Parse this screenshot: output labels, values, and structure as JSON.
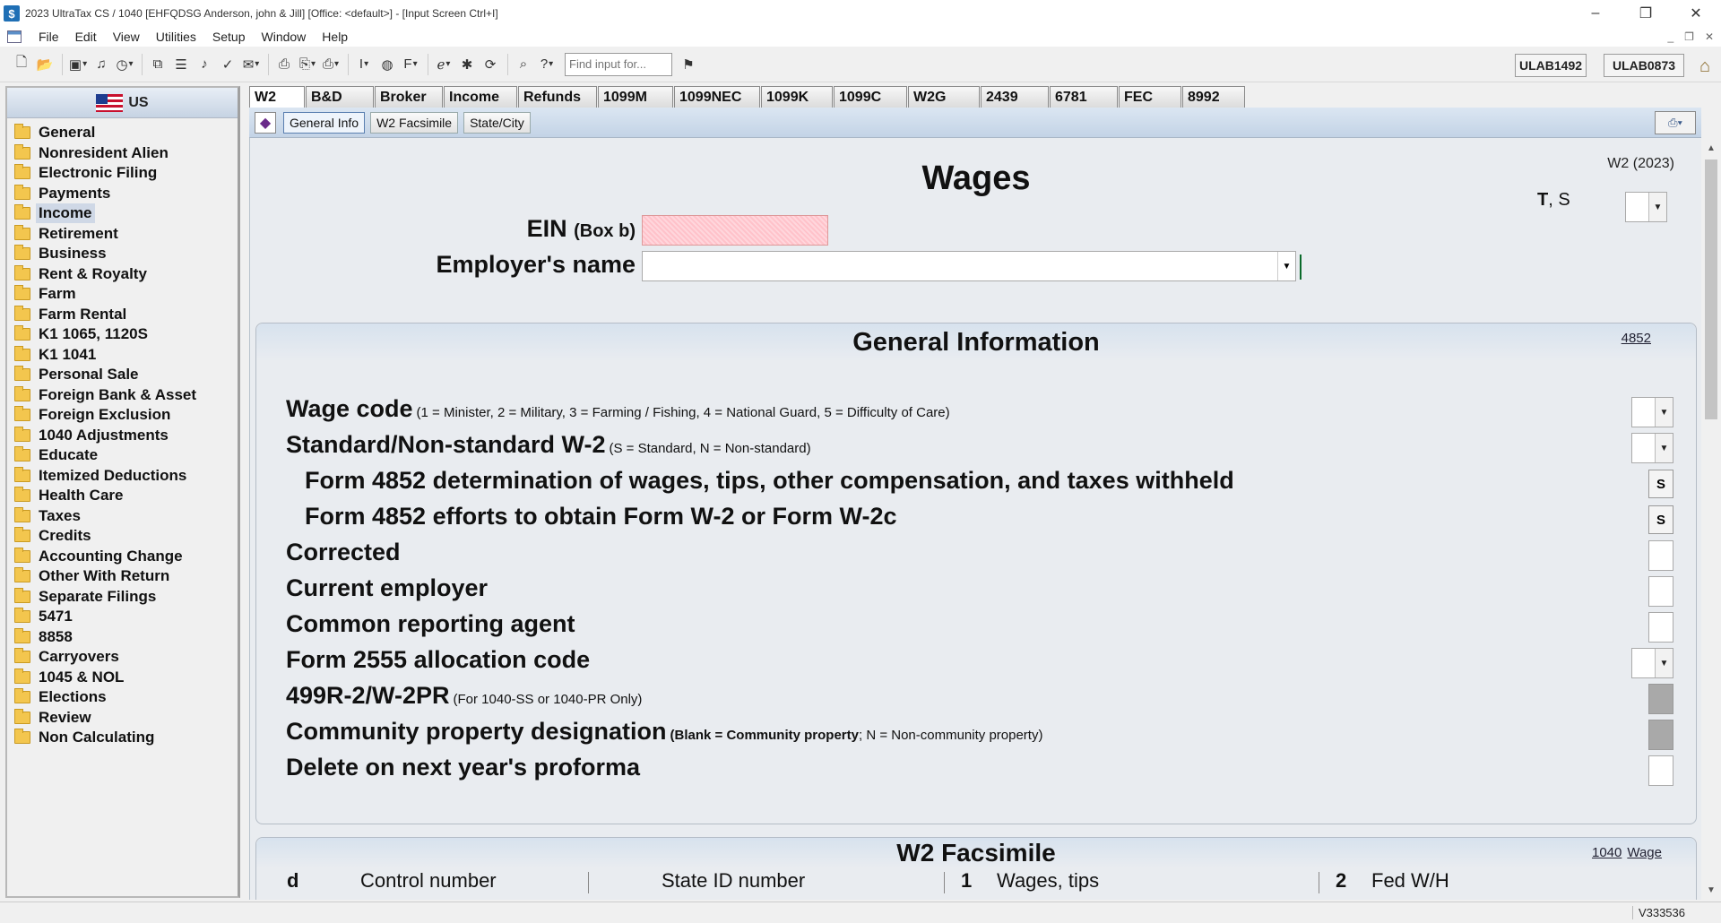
{
  "window": {
    "title": "2023 UltraTax CS  / 1040 [EHFQDSG Anderson, john & Jill] [Office: <default>] - [Input Screen     Ctrl+I]",
    "app_icon": "$"
  },
  "menu": [
    "File",
    "Edit",
    "View",
    "Utilities",
    "Setup",
    "Window",
    "Help"
  ],
  "toolbar": {
    "find_placeholder": "Find input for...",
    "user1": "ULAB1492",
    "user2": "ULAB0873"
  },
  "sidebar": {
    "header": "US",
    "selected": "Income",
    "items": [
      "General",
      "Nonresident Alien",
      "Electronic Filing",
      "Payments",
      "Income",
      "Retirement",
      "Business",
      "Rent & Royalty",
      "Farm",
      "Farm Rental",
      "K1 1065, 1120S",
      "K1 1041",
      "Personal Sale",
      "Foreign Bank & Asset",
      "Foreign Exclusion",
      "1040 Adjustments",
      "Educate",
      "Itemized Deductions",
      "Health Care",
      "Taxes",
      "Credits",
      "Accounting Change",
      "Other With Return",
      "Separate Filings",
      "5471",
      "8858",
      "Carryovers",
      "1045 & NOL",
      "Elections",
      "Review",
      "Non Calculating"
    ]
  },
  "tabs": [
    "W2",
    "B&D",
    "Broker",
    "Income",
    "Refunds",
    "1099M",
    "1099NEC",
    "1099K",
    "1099C",
    "W2G",
    "2439",
    "6781",
    "FEC",
    "8992"
  ],
  "active_tab": "W2",
  "subtabs": [
    "General Info",
    "W2 Facsimile",
    "State/City"
  ],
  "active_subtab": "General Info",
  "form": {
    "title": "Wages",
    "form_id": "W2 (2023)",
    "ts_bold": "T",
    "ts_rest": ", S",
    "ein_label": "EIN",
    "ein_sub": "(Box b)",
    "ein_value": "",
    "employer_label": "Employer's name",
    "employer_value": ""
  },
  "general_info": {
    "title": "General Information",
    "link": "4852",
    "rows": [
      {
        "label": "Wage code",
        "note": "(1 = Minister, 2 = Military, 3 = Farming / Fishing, 4 = National Guard, 5 = Difficulty of Care)"
      },
      {
        "label": "Standard/Non-standard W-2",
        "note": "(S = Standard, N = Non-standard)"
      },
      {
        "label": "Form 4852 determination of wages, tips, other compensation, and taxes withheld",
        "note": "",
        "button": "S"
      },
      {
        "label": "Form 4852 efforts to obtain Form W-2 or Form W-2c",
        "note": "",
        "button": "S"
      },
      {
        "label": "Corrected",
        "note": ""
      },
      {
        "label": "Current employer",
        "note": ""
      },
      {
        "label": "Common reporting agent",
        "note": ""
      },
      {
        "label": "Form 2555 allocation code",
        "note": ""
      },
      {
        "label": "499R-2/W-2PR",
        "note": "(For 1040-SS or 1040-PR Only)"
      },
      {
        "label": "Community property designation",
        "note_bold": "(Blank = Community property",
        "note": "; N = Non-community property)"
      },
      {
        "label": "Delete on next year's proforma",
        "note": ""
      }
    ]
  },
  "w2_facsimile": {
    "title": "W2 Facsimile",
    "links": [
      "1040",
      "Wage"
    ],
    "columns": [
      {
        "box": "d",
        "label": "Control number"
      },
      {
        "box": "",
        "label": "State ID number"
      },
      {
        "box": "1",
        "label": "Wages, tips"
      },
      {
        "box": "2",
        "label": "Fed W/H"
      }
    ]
  },
  "status": {
    "version": "V333536"
  }
}
